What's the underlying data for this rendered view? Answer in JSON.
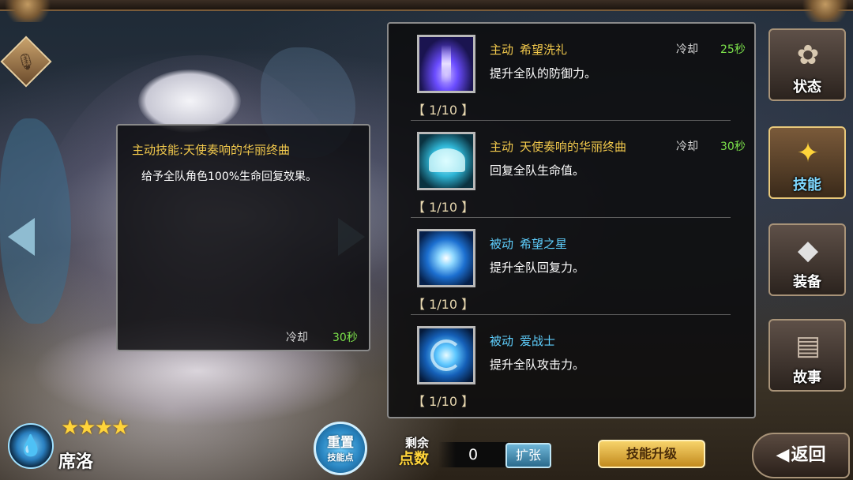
{
  "tooltip": {
    "title": "主动技能:天使奏响的华丽终曲",
    "description": "给予全队角色100%生命回复效果。",
    "cooldown_label": "冷却",
    "cooldown_value": "30秒"
  },
  "skills": [
    {
      "type": "主动",
      "name": "希望洗礼",
      "description": "提升全队的防御力。",
      "cooldown_label": "冷却",
      "cooldown_value": "25秒",
      "level": "【 1/10 】",
      "icon": "light-pillar-icon"
    },
    {
      "type": "主动",
      "name": "天使奏响的华丽终曲",
      "description": "回复全队生命值。",
      "cooldown_label": "冷却",
      "cooldown_value": "30秒",
      "level": "【 1/10 】",
      "icon": "angel-wings-icon"
    },
    {
      "type": "被动",
      "name": "希望之星",
      "description": "提升全队回复力。",
      "level": "【 1/10 】",
      "icon": "star-burst-icon"
    },
    {
      "type": "被动",
      "name": "爱战士",
      "description": "提升全队攻击力。",
      "level": "【 1/10 】",
      "icon": "water-swirl-icon"
    }
  ],
  "side_tabs": [
    {
      "label": "状态",
      "icon": "status-icon",
      "active": false
    },
    {
      "label": "技能",
      "icon": "skill-icon",
      "active": true
    },
    {
      "label": "装备",
      "icon": "equipment-icon",
      "active": false
    },
    {
      "label": "故事",
      "icon": "story-book-icon",
      "active": false
    }
  ],
  "character": {
    "name": "席洛",
    "stars": "★★★★",
    "element_icon": "water-drop-icon"
  },
  "reset": {
    "line1": "重置",
    "line2": "技能点"
  },
  "points": {
    "label_top": "剩余",
    "label_bottom": "点数",
    "value": "0",
    "expand_label": "扩张"
  },
  "upgrade_label": "技能升级",
  "back_label": "返回",
  "colors": {
    "active_type": "#f2c94c",
    "passive_type": "#5fd0ff",
    "cooldown_value": "#7be04a"
  }
}
